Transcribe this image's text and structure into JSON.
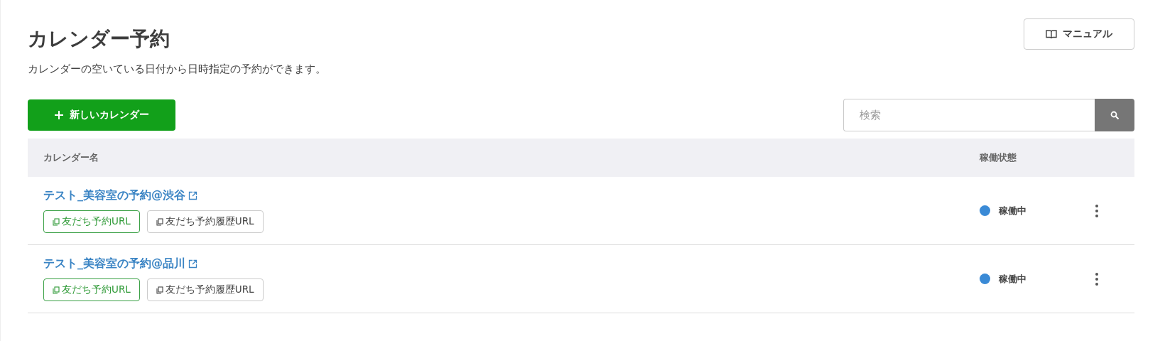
{
  "header": {
    "title": "カレンダー予約",
    "description": "カレンダーの空いている日付から日時指定の予約ができます。",
    "manual_button": "マニュアル"
  },
  "toolbar": {
    "new_button": "新しいカレンダー",
    "search": {
      "placeholder": "検索"
    }
  },
  "table": {
    "columns": [
      "カレンダー名",
      "稼働状態"
    ],
    "rows": [
      {
        "name": "テスト_美容室の予約@渋谷",
        "links": [
          {
            "label": "友だち予約URL",
            "kind": "primary"
          },
          {
            "label": "友だち予約履歴URL",
            "kind": "secondary"
          }
        ],
        "status": {
          "label": "稼働中",
          "color": "#3a8ad6"
        }
      },
      {
        "name": "テスト_美容室の予約@品川",
        "links": [
          {
            "label": "友だち予約URL",
            "kind": "primary"
          },
          {
            "label": "友だち予約履歴URL",
            "kind": "secondary"
          }
        ],
        "status": {
          "label": "稼働中",
          "color": "#3a8ad6"
        }
      }
    ]
  }
}
